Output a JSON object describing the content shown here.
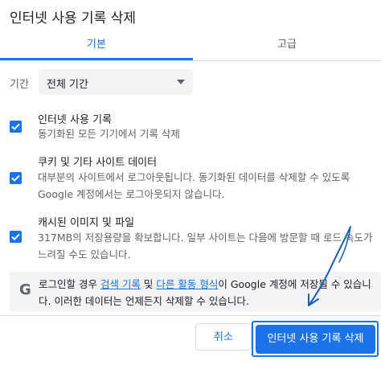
{
  "dialog": {
    "title": "인터넷 사용 기록 삭제"
  },
  "tabs": [
    {
      "label": "기본",
      "active": true
    },
    {
      "label": "고급",
      "active": false
    }
  ],
  "time_range": {
    "label": "기간",
    "selected": "전체 기간"
  },
  "items": [
    {
      "title": "인터넷 사용 기록",
      "description": "동기화된 모든 기기에서 기록 삭제",
      "checked": true
    },
    {
      "title": "쿠키 및 기타 사이트 데이터",
      "description": "대부분의 사이트에서 로그아웃됩니다. 동기화된 데이터를 삭제할 수 있도록 Google 계정에서는 로그아웃되지 않습니다.",
      "checked": true
    },
    {
      "title": "캐시된 이미지 및 파일",
      "description": "317MB의 저장용량을 확보합니다. 일부 사이트는 다음에 방문할 때 로드 속도가 느려질 수도 있습니다.",
      "checked": true
    }
  ],
  "info": {
    "logo": "G",
    "text_before": "로그인할 경우 ",
    "link1": "검색 기록",
    "text_mid": " 및 ",
    "link2": "다른 활동 형식",
    "text_after": "이 Google 계정에 저장될 수 있습니다. 이러한 데이터는 언제든지 삭제할 수 있습니다."
  },
  "buttons": {
    "cancel": "취소",
    "delete": "인터넷 사용 기록 삭제"
  },
  "colors": {
    "accent": "#1a73e8",
    "annotation": "#1a5fb4"
  }
}
